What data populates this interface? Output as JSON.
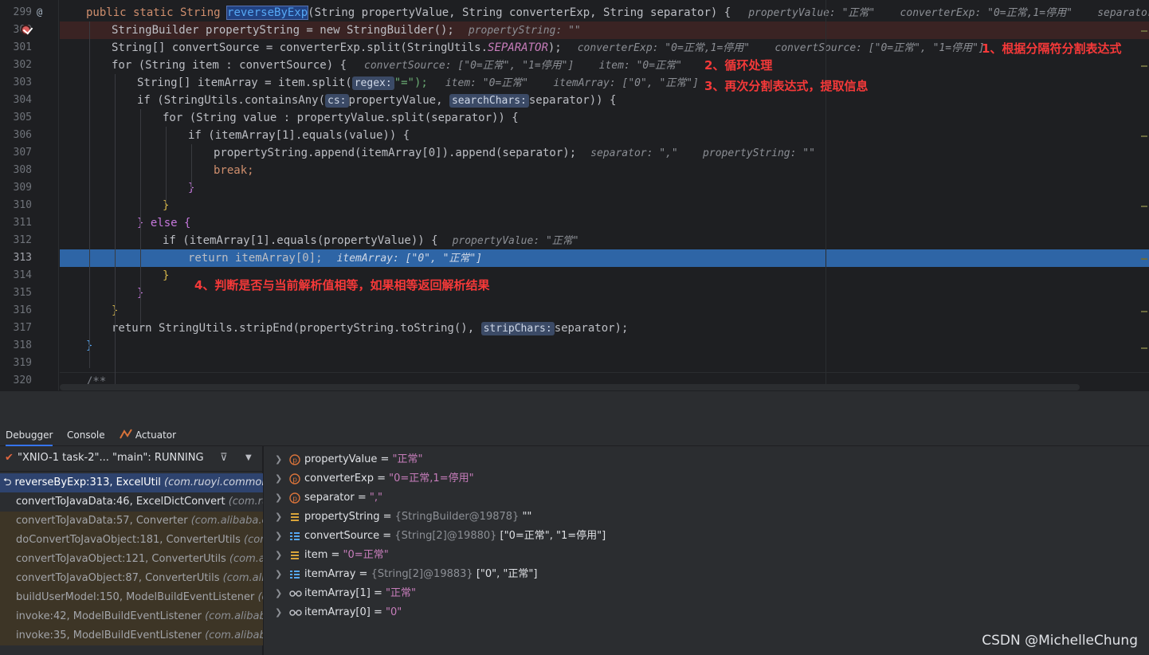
{
  "editor": {
    "lines": [
      "299",
      "300",
      "301",
      "302",
      "303",
      "304",
      "305",
      "306",
      "307",
      "308",
      "309",
      "310",
      "311",
      "312",
      "313",
      "314",
      "315",
      "316",
      "317",
      "318",
      "319",
      "320"
    ],
    "method_name": "reverseByExp",
    "code": {
      "l299_pre": "public static String ",
      "l299_post": "(String propertyValue, String converterExp, String separator) {",
      "l299_hint": "propertyValue: \"正常\"    converterExp: \"0=正常,1=停用\"    separator: \",\"",
      "l300": "StringBuilder propertyString = new StringBuilder();",
      "l300_hint": "propertyString: \"\"",
      "l301_a": "String[] convertSource = converterExp.split(StringUtils.",
      "l301_b": "SEPARATOR",
      "l301_c": ");",
      "l301_hint": "converterExp: \"0=正常,1=停用\"    convertSource: [\"0=正常\", \"1=停用\"]",
      "l302": "for (String item : convertSource) {",
      "l302_hint": "convertSource: [\"0=正常\", \"1=停用\"]    item: \"0=正常\"",
      "l303_a": "String[] itemArray = item.split(",
      "l303_ph": "regex:",
      "l303_b": "\"=\");",
      "l303_hint": "item: \"0=正常\"    itemArray: [\"0\", \"正常\"]",
      "l304_a": "if (StringUtils.containsAny(",
      "l304_ph1": "cs:",
      "l304_b": "propertyValue, ",
      "l304_ph2": "searchChars:",
      "l304_c": "separator)) {",
      "l305": "for (String value : propertyValue.split(separator)) {",
      "l306": "if (itemArray[1].equals(value)) {",
      "l307": "propertyString.append(itemArray[0]).append(separator);",
      "l307_hint": "separator: \",\"    propertyString: \"\"",
      "l308": "break;",
      "l309": "}",
      "l310": "}",
      "l311": "} else {",
      "l312": "if (itemArray[1].equals(propertyValue)) {",
      "l312_hint": "propertyValue: \"正常\"",
      "l313": "return itemArray[0];",
      "l313_hint": "itemArray: [\"0\", \"正常\"]",
      "l314": "}",
      "l315": "}",
      "l316": "}",
      "l317_a": "return StringUtils.stripEnd(propertyString.toString(), ",
      "l317_ph": "stripChars:",
      "l317_b": "separator);",
      "l318": "}",
      "l319": "",
      "l320": "/**"
    }
  },
  "annotations": {
    "a1": "1、根据分隔符分割表达式",
    "a2": "2、循环处理",
    "a3": "3、再次分割表达式，提取信息",
    "a4": "4、判断是否与当前解析值相等，如果相等返回解析结果"
  },
  "colors": {
    "annotation": "#f53939",
    "exec_line": "#2e65a6",
    "breakpoint": "#db5c5c"
  },
  "tabs": [
    "Debugger",
    "Console",
    "Actuator"
  ],
  "thread": "\"XNIO-1 task-2\"... \"main\": RUNNING",
  "frames": [
    {
      "m": "reverseByExp:313, ExcelUtil ",
      "p": "(com.ruoyi.common.ex"
    },
    {
      "m": "convertToJavaData:46, ExcelDictConvert ",
      "p": "(com.ruo"
    },
    {
      "m": "convertToJavaData:57, Converter ",
      "p": "(com.alibaba.exc"
    },
    {
      "m": "doConvertToJavaObject:181, ConverterUtils ",
      "p": "(com."
    },
    {
      "m": "convertToJavaObject:121, ConverterUtils ",
      "p": "(com.alib"
    },
    {
      "m": "convertToJavaObject:87, ConverterUtils ",
      "p": "(com.aliba"
    },
    {
      "m": "buildUserModel:150, ModelBuildEventListener ",
      "p": "(co"
    },
    {
      "m": "invoke:42, ModelBuildEventListener ",
      "p": "(com.alibaba.e"
    },
    {
      "m": "invoke:35, ModelBuildEventListener ",
      "p": "(com.alibaba.e"
    }
  ],
  "variables": [
    {
      "icon": "param-icon",
      "name": "propertyValue",
      "ref": "",
      "value": "\"正常\""
    },
    {
      "icon": "param-icon",
      "name": "converterExp",
      "ref": "",
      "value": "\"0=正常,1=停用\""
    },
    {
      "icon": "param-icon",
      "name": "separator",
      "ref": "",
      "value": "\",\""
    },
    {
      "icon": "object-icon",
      "name": "propertyString",
      "ref": "{StringBuilder@19878}",
      "value": "\"\""
    },
    {
      "icon": "array-icon",
      "name": "convertSource",
      "ref": "{String[2]@19880}",
      "value": "[\"0=正常\", \"1=停用\"]"
    },
    {
      "icon": "object-icon",
      "name": "item",
      "ref": "",
      "value": "\"0=正常\""
    },
    {
      "icon": "array-icon",
      "name": "itemArray",
      "ref": "{String[2]@19883}",
      "value": "[\"0\", \"正常\"]"
    },
    {
      "icon": "watch-icon",
      "name": "itemArray[1]",
      "ref": "",
      "value": "\"正常\""
    },
    {
      "icon": "watch-icon",
      "name": "itemArray[0]",
      "ref": "",
      "value": "\"0\""
    }
  ],
  "watermark": "CSDN @MichelleChung"
}
